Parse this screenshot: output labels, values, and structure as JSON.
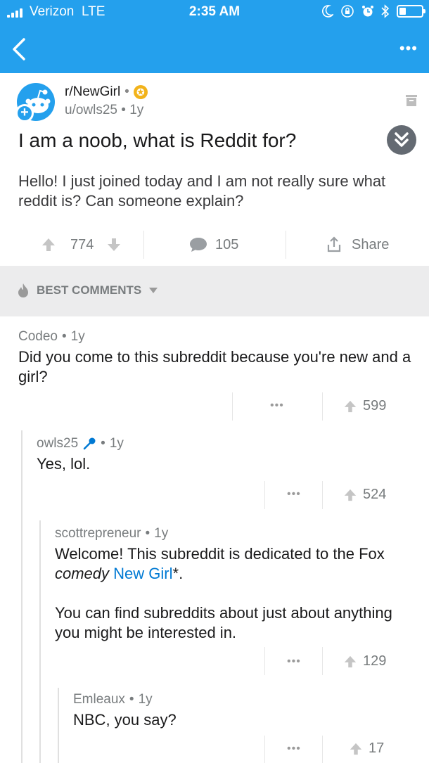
{
  "status_bar": {
    "carrier": "Verizon",
    "network": "LTE",
    "time": "2:35 AM"
  },
  "post": {
    "subreddit": "r/NewGirl",
    "author": "u/owls25",
    "age": "1y",
    "title": "I am a noob, what is Reddit for?",
    "body": "Hello! I just joined today and I am not really sure what reddit is? Can someone explain?",
    "score": "774",
    "comments_count": "105",
    "share_label": "Share"
  },
  "sort": {
    "label": "BEST COMMENTS"
  },
  "comments": [
    {
      "author": "Codeo",
      "age": "1y",
      "body": "Did you come to this subreddit because you're new and a girl?",
      "score": "599"
    },
    {
      "author": "owls25",
      "age": "1y",
      "body": "Yes, lol.",
      "score": "524"
    },
    {
      "author": "scottrepreneur",
      "age": "1y",
      "body_prefix": "Welcome! This subreddit is dedicated to the Fox",
      "body_em": "comedy",
      "body_link": "New Girl",
      "body_suffix": "*.",
      "body_para2": "You can find subreddits about just about anything you might be interested in.",
      "score": "129"
    },
    {
      "author": "Emleaux",
      "age": "1y",
      "body": "NBC, you say?",
      "score": "17"
    }
  ],
  "more_label": "•••",
  "bullet": "•",
  "colors": {
    "brand_blue": "#24a0ed",
    "link_blue": "#0079d3",
    "gold": "#f2b31b",
    "gray_text": "#787c7e"
  }
}
